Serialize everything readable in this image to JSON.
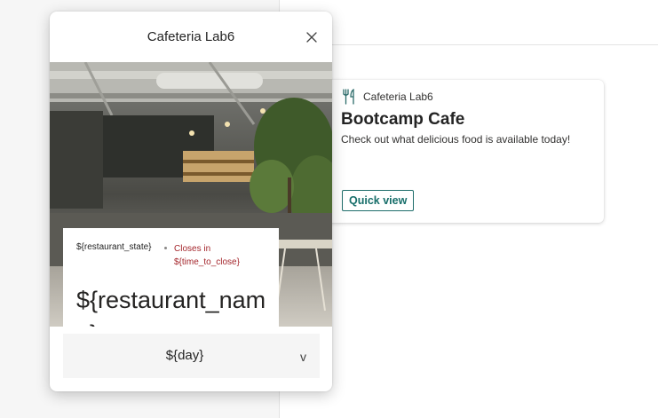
{
  "card": {
    "app_name": "Cafeteria Lab6",
    "app_icon": "fork-knife-icon",
    "title": "Bootcamp Cafe",
    "description": "Check out what delicious food is available today!",
    "button_label": "Quick view",
    "accent_color": "#176e6a"
  },
  "dialog": {
    "title": "Cafeteria Lab6",
    "close_icon": "close-icon",
    "image": "cafe-interior-photo",
    "restaurant_state": "${restaurant_state}",
    "closes_line1": "Closes in",
    "closes_line2": "${time_to_close}",
    "closes_color": "#a4262c",
    "restaurant_name": "${restaurant_name}",
    "day_value": "${day}",
    "day_chevron": "v"
  }
}
